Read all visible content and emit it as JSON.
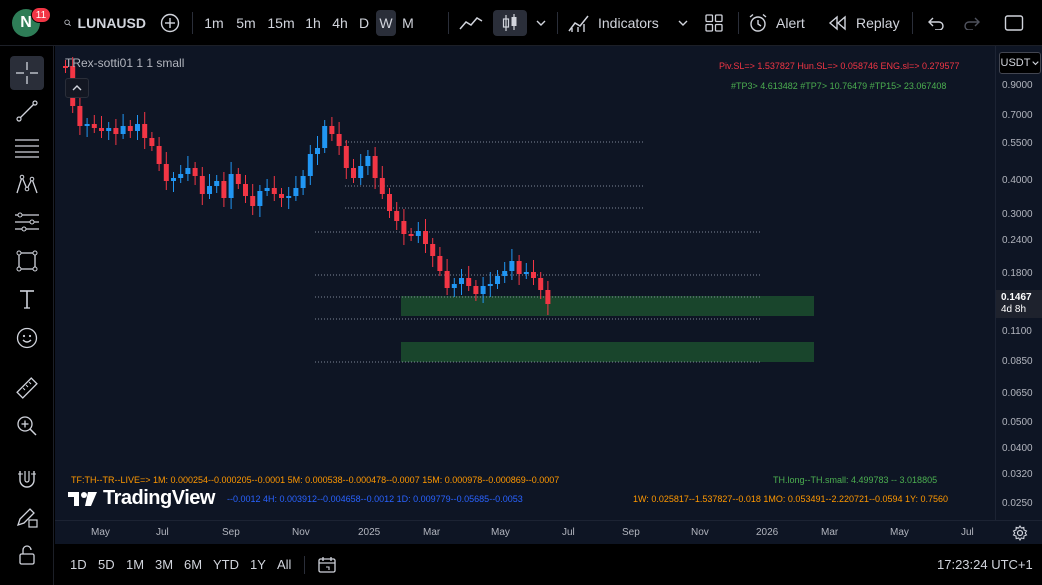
{
  "header": {
    "avatar_letter": "N",
    "notification_count": "11",
    "symbol": "LUNAUSD",
    "intervals": [
      "1m",
      "5m",
      "15m",
      "1h",
      "4h",
      "D",
      "W",
      "M"
    ],
    "active_interval": "W",
    "indicators_label": "Indicators",
    "alert_label": "Alert",
    "replay_label": "Replay"
  },
  "chart": {
    "legend_title": "TRex-sotti01 1 1 small",
    "anno_top1": "Piv.SL=> 1.537827  Hun.SL=> 0.058746  ENG.sl=> 0.279577",
    "anno_top2": "#TP3> 4.613482  #TP7> 10.76479  #TP15> 23.067408",
    "anno_live": "TF:TH--TR--LIVE=>   1M: 0.000254--0.000205--0.0001    5M: 0.000538--0.000478--0.0007    15M: 0.000978--0.000869--0.0007",
    "anno_row2a": "--0.0012    4H: 0.003912--0.004658--0.0012    1D: 0.009779--0.05685--0.0053",
    "anno_row2b": "1W: 0.025817--1.537827--0.018    1MO: 0.053491--2.220721--0.0594    1Y: 0.7560",
    "anno_th": "TH.long--TH.small: 4.499783 -- 3.018805",
    "logo_text": "TradingView"
  },
  "price_axis": {
    "currency": "USDT",
    "labels": [
      "0.9000",
      "0.7000",
      "0.5500",
      "0.4000",
      "0.3000",
      "0.2400",
      "0.1800",
      "0.1100",
      "0.0850",
      "0.0650",
      "0.0500",
      "0.0400",
      "0.0320",
      "0.0250"
    ],
    "current_price": "0.1467",
    "countdown": "4d 8h"
  },
  "time_axis": {
    "labels": [
      "May",
      "Jul",
      "Sep",
      "Nov",
      "2025",
      "Mar",
      "May",
      "Jul",
      "Sep",
      "Nov",
      "2026",
      "Mar",
      "May",
      "Jul"
    ]
  },
  "bottom": {
    "ranges": [
      "1D",
      "5D",
      "1M",
      "3M",
      "6M",
      "YTD",
      "1Y",
      "All"
    ],
    "clock": "17:23:24 UTC+1"
  },
  "colors": {
    "up": "#2196f3",
    "down": "#f23645",
    "zone": "#1b4d2e",
    "background": "#0e1524"
  }
}
